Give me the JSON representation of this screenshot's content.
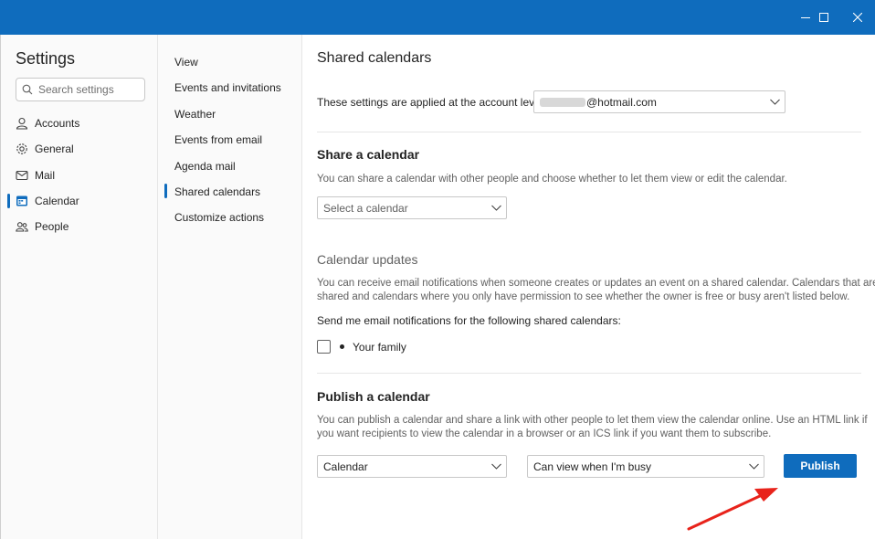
{
  "settings": {
    "title": "Settings",
    "search_placeholder": "Search settings",
    "nav": [
      {
        "label": "Accounts",
        "icon": "person-icon"
      },
      {
        "label": "General",
        "icon": "gear-icon"
      },
      {
        "label": "Mail",
        "icon": "mail-icon"
      },
      {
        "label": "Calendar",
        "icon": "calendar-icon",
        "active": true
      },
      {
        "label": "People",
        "icon": "people-icon"
      }
    ]
  },
  "calendar_nav": [
    {
      "label": "View"
    },
    {
      "label": "Events and invitations"
    },
    {
      "label": "Weather"
    },
    {
      "label": "Events from email"
    },
    {
      "label": "Agenda mail"
    },
    {
      "label": "Shared calendars",
      "active": true
    },
    {
      "label": "Customize actions"
    }
  ],
  "main": {
    "title": "Shared calendars",
    "account_label": "These settings are applied at the account level:",
    "account_value": "@hotmail.com",
    "share": {
      "title": "Share a calendar",
      "description": "You can share a calendar with other people and choose whether to let them view or edit the calendar.",
      "select_placeholder": "Select a calendar"
    },
    "updates": {
      "title": "Calendar updates",
      "description_line1": "You can receive email notifications when someone creates or updates an event on a shared calendar. Calendars that aren't",
      "description_line2": "shared and calendars where you only have permission to see whether the owner is free or busy aren't listed below.",
      "send_label": "Send me email notifications for the following shared calendars:",
      "calendar_item": "Your family",
      "calendar_item_checked": false
    },
    "publish": {
      "title": "Publish a calendar",
      "description_line1": "You can publish a calendar and share a link with other people to let them view the calendar online. Use an HTML link if",
      "description_line2": "you want recipients to view the calendar in a browser or an ICS link if you want them to subscribe.",
      "calendar_select": "Calendar",
      "permission_select": "Can view when I'm busy",
      "button_label": "Publish"
    }
  },
  "colors": {
    "accent": "#0f6cbd",
    "annotation_arrow": "#e8231b"
  }
}
